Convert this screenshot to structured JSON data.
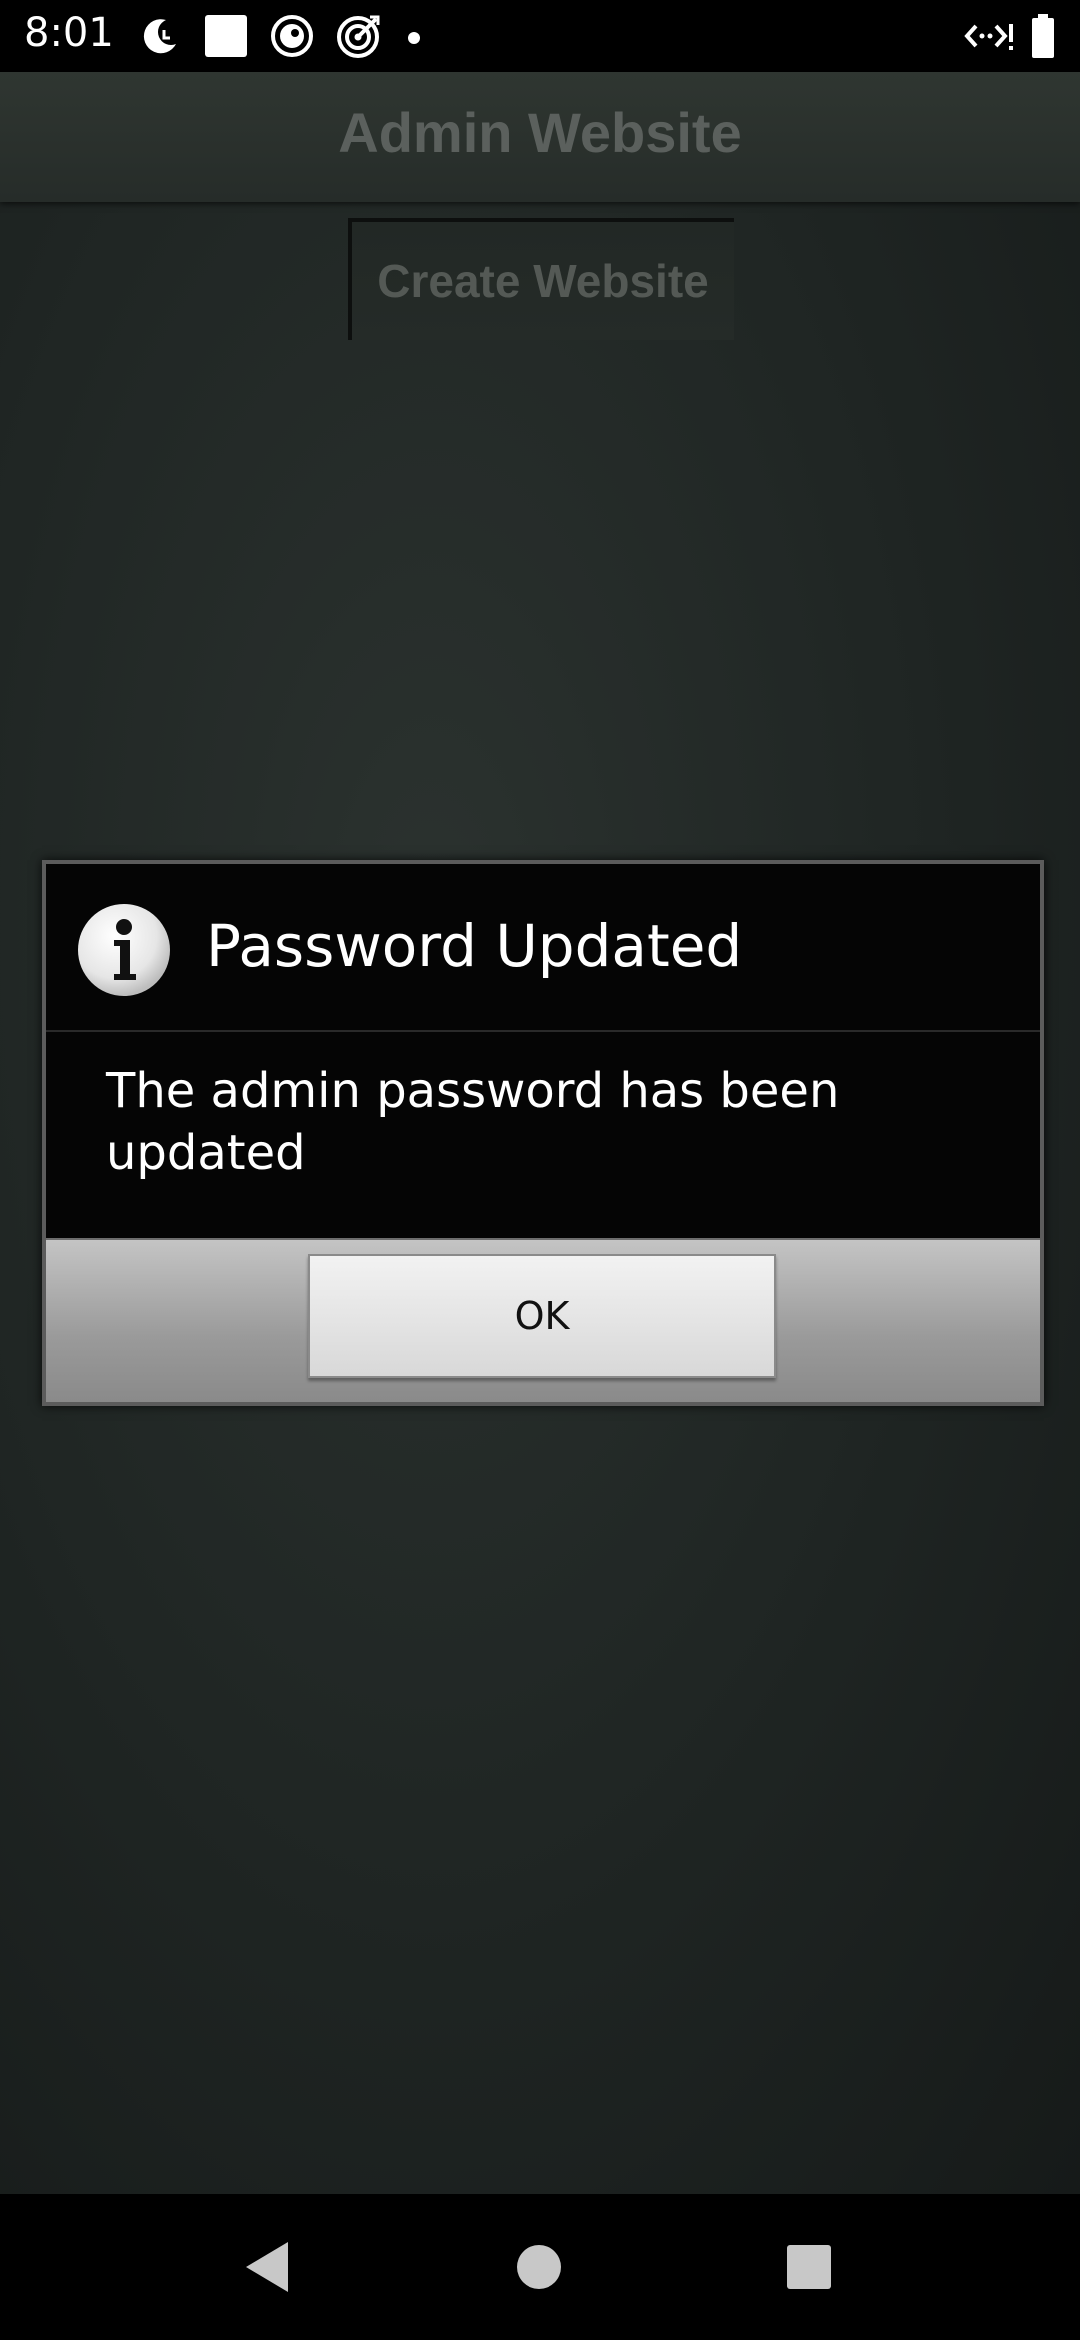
{
  "status_bar": {
    "time": "8:01",
    "icons_left": [
      "moon-clock-icon",
      "square-icon",
      "circle-dot-icon",
      "target-icon",
      "dot-icon"
    ],
    "icons_right": [
      "data-arrows-icon",
      "battery-icon"
    ]
  },
  "app_bar": {
    "title": "Admin Website"
  },
  "main": {
    "create_button_label": "Create Website"
  },
  "dialog": {
    "title": "Password Updated",
    "icon": "info-icon",
    "message": "The admin password has been updated",
    "ok_label": "OK"
  },
  "nav_bar": {
    "buttons": [
      "back-icon",
      "home-icon",
      "recents-icon"
    ]
  },
  "colors": {
    "status_bar_bg": "#000000",
    "app_bg": "#1f2523",
    "dimmed_title": "#5b605d",
    "dialog_bg": "#050505",
    "dialog_button_bar": "#a8a8a8"
  }
}
